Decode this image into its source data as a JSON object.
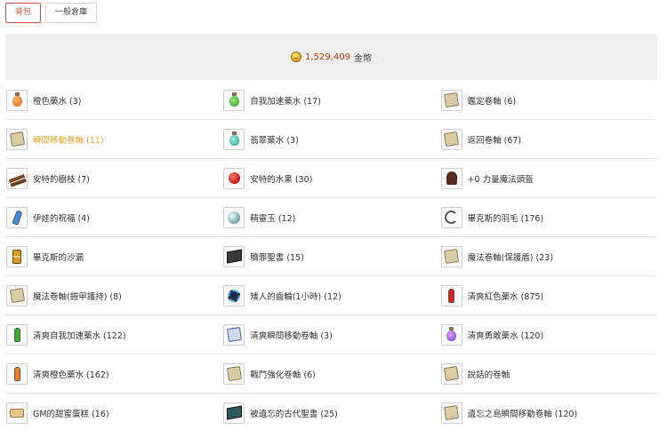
{
  "tabs": [
    {
      "label": "背包",
      "active": true
    },
    {
      "label": "一般倉庫",
      "active": false
    }
  ],
  "balance": {
    "icon": "gold-coin-icon",
    "amount": "1,529,409",
    "unit": "金幣"
  },
  "items": [
    {
      "label": "橙色藥水 (3)",
      "icon": "orange-potion-icon"
    },
    {
      "label": "自我加速藥水 (17)",
      "icon": "green-potion-icon"
    },
    {
      "label": "鑑定卷軸 (6)",
      "icon": "scroll-icon"
    },
    {
      "label": "瞬間移動卷軸 (11)",
      "icon": "scroll-icon",
      "highlight": true
    },
    {
      "label": "翡翠藥水 (3)",
      "icon": "teal-potion-icon"
    },
    {
      "label": "返回卷軸 (67)",
      "icon": "scroll-icon"
    },
    {
      "label": "安特的樹枝 (7)",
      "icon": "twig-icon"
    },
    {
      "label": "安特的水果 (30)",
      "icon": "apple-icon"
    },
    {
      "label": "+0 力量魔法頭盔",
      "icon": "helmet-icon"
    },
    {
      "label": "伊娃的祝福 (4)",
      "icon": "blue-vial-icon"
    },
    {
      "label": "精靈玉 (12)",
      "icon": "orb-icon"
    },
    {
      "label": "畢克斯的羽毛 (176)",
      "icon": "feather-ring-icon"
    },
    {
      "label": "畢克斯的沙漏",
      "icon": "hourglass-icon"
    },
    {
      "label": "贖罪聖書 (15)",
      "icon": "book-icon"
    },
    {
      "label": "魔法卷軸(保護盾) (23)",
      "icon": "scroll-icon"
    },
    {
      "label": "魔法卷軸(鎧甲護持) (8)",
      "icon": "scroll-icon"
    },
    {
      "label": "矮人的齒輪(1小時) (12)",
      "icon": "gear-icon"
    },
    {
      "label": "清爽紅色藥水 (875)",
      "icon": "red-vial-icon"
    },
    {
      "label": "清爽自我加速藥水 (122)",
      "icon": "green-vial-icon"
    },
    {
      "label": "清爽瞬間移動卷軸 (3)",
      "icon": "blue-scroll-icon"
    },
    {
      "label": "清爽勇敢藥水 (120)",
      "icon": "purple-potion-icon"
    },
    {
      "label": "清爽橙色藥水 (162)",
      "icon": "orange-vial-icon"
    },
    {
      "label": "戰鬥強化卷軸 (6)",
      "icon": "scroll-icon"
    },
    {
      "label": "說話的卷軸",
      "icon": "scroll-icon"
    },
    {
      "label": "GM的甜蜜蛋糕 (16)",
      "icon": "cake-icon"
    },
    {
      "label": "被遺忘的古代聖書 (25)",
      "icon": "teal-book-icon"
    },
    {
      "label": "遺忘之島瞬間移動卷軸 (120)",
      "icon": "scroll-icon"
    }
  ],
  "colors": {
    "accent": "#c4553a",
    "highlight": "#e8a02a",
    "amount": "#b7410e",
    "panel": "#efefef"
  }
}
